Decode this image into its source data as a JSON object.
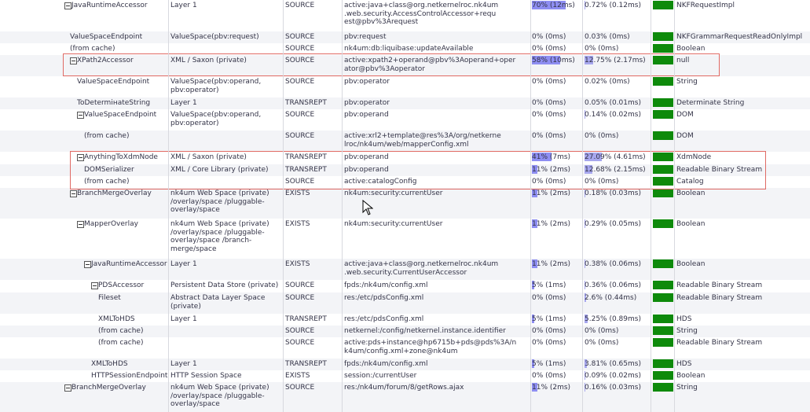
{
  "rows": [
    {
      "name": "JavaRuntimeAccessor",
      "toggle": true,
      "space": "Layer 1",
      "verb": "SOURCE",
      "uri": "active:java+class@org.netkernelroc.nk4um\n.web.security.AccessControlAccessor+requ\nest@pbv%3Arequest",
      "pct1": "70% (12ms)",
      "pct1_val": 70,
      "pct2": "0.72% (0.12ms)",
      "pct2_val": 0.72,
      "type": "NKFRequestImpl"
    },
    {
      "name": "ValueSpaceEndpoint",
      "toggle": false,
      "space": "ValueSpace(pbv:request)",
      "verb": "SOURCE",
      "uri": "pbv:request",
      "pct1": "0% (0ms)",
      "pct1_val": 0,
      "pct2": "0.03% (0ms)",
      "pct2_val": 0.03,
      "type": "NKFGrammarRequestReadOnlyImpl"
    },
    {
      "name": "(from cache)",
      "toggle": false,
      "space": "",
      "verb": "SOURCE",
      "uri": "nk4um:db:liquibase:updateAvailable",
      "pct1": "0% (0ms)",
      "pct1_val": 0,
      "pct2": "0% (0ms)",
      "pct2_val": 0,
      "type": "Boolean"
    },
    {
      "name": "XPath2Accessor",
      "toggle": true,
      "space": "XML / Saxon (private)",
      "verb": "SOURCE",
      "uri": "active:xpath2+operand@pbv%3Aoperand+oper\nator@pbv%3Aoperator",
      "pct1": "58% (10ms)",
      "pct1_val": 58,
      "pct2": "12.75% (2.17ms)",
      "pct2_val": 12.75,
      "type": "null"
    },
    {
      "name": "ValueSpaceEndpoint",
      "toggle": false,
      "space": "ValueSpace(pbv:operand,\npbv:operator)",
      "verb": "SOURCE",
      "uri": "pbv:operator",
      "pct1": "0% (0ms)",
      "pct1_val": 0,
      "pct2": "0.02% (0ms)",
      "pct2_val": 0.02,
      "type": "String"
    },
    {
      "name": "ToDetermінateString",
      "toggle": false,
      "space": "Layer 1",
      "verb": "TRANSREPT",
      "uri": "pbv:operator",
      "pct1": "0% (0ms)",
      "pct1_val": 0,
      "pct2": "0.05% (0.01ms)",
      "pct2_val": 0.05,
      "type": "Determinate String"
    },
    {
      "name": "ValueSpaceEndpoint",
      "toggle": true,
      "space": "ValueSpace(pbv:operand,\npbv:operator)",
      "verb": "SOURCE",
      "uri": "pbv:operand",
      "pct1": "0% (0ms)",
      "pct1_val": 0,
      "pct2": "0.14% (0.02ms)",
      "pct2_val": 0.14,
      "type": "DOM"
    },
    {
      "name": "(from cache)",
      "toggle": false,
      "space": "",
      "verb": "SOURCE",
      "uri": "active:xrl2+template@res%3A/org/netkerne\nlroc/nk4um/web/mapperConfig.xml",
      "pct1": "0% (0ms)",
      "pct1_val": 0,
      "pct2": "0% (0ms)",
      "pct2_val": 0,
      "type": "DOM"
    },
    {
      "name": "AnythingToXdmNode",
      "toggle": true,
      "space": "XML / Saxon (private)",
      "verb": "TRANSREPT",
      "uri": "pbv:operand",
      "pct1": "41% (7ms)",
      "pct1_val": 41,
      "pct2": "27.09% (4.61ms)",
      "pct2_val": 27.09,
      "type": "XdmNode"
    },
    {
      "name": "DOMSerializer",
      "toggle": false,
      "space": "XML / Core Library (private)",
      "verb": "TRANSREPT",
      "uri": "pbv:operand",
      "pct1": "11% (2ms)",
      "pct1_val": 11,
      "pct2": "12.68% (2.15ms)",
      "pct2_val": 12.68,
      "type": "Readable Binary Stream"
    },
    {
      "name": "(from cache)",
      "toggle": false,
      "space": "",
      "verb": "SOURCE",
      "uri": "active:catalogConfig",
      "pct1": "0% (0ms)",
      "pct1_val": 0,
      "pct2": "0% (0ms)",
      "pct2_val": 0,
      "type": "Catalog"
    },
    {
      "name": "BranchMergeOverlay",
      "toggle": true,
      "space": "nk4um Web Space (private)\n/overlay/space /pluggable-\noverlay/space",
      "verb": "EXISTS",
      "uri": "nk4um:security:currentUser",
      "pct1": "11% (2ms)",
      "pct1_val": 11,
      "pct2": "0.18% (0.03ms)",
      "pct2_val": 0.18,
      "type": "Boolean"
    },
    {
      "name": "MapperOverlay",
      "toggle": true,
      "space": "nk4um Web Space (private)\n/overlay/space /pluggable-\noverlay/space /branch-\nmerge/space",
      "verb": "EXISTS",
      "uri": "nk4um:security:currentUser",
      "pct1": "11% (2ms)",
      "pct1_val": 11,
      "pct2": "0.29% (0.05ms)",
      "pct2_val": 0.29,
      "type": "Boolean"
    },
    {
      "name": "JavaRuntimeAccessor",
      "toggle": true,
      "space": "Layer 1",
      "verb": "EXISTS",
      "uri": "active:java+class@org.netkernelroc.nk4um\n.web.security.CurrentUserAccessor",
      "pct1": "11% (2ms)",
      "pct1_val": 11,
      "pct2": "0.38% (0.06ms)",
      "pct2_val": 0.38,
      "type": "Boolean"
    },
    {
      "name": "PDSAccessor",
      "toggle": true,
      "space": "Persistent Data Store (private)",
      "verb": "SOURCE",
      "uri": "fpds:/nk4um/config.xml",
      "pct1": "5% (1ms)",
      "pct1_val": 5,
      "pct2": "0.36% (0.06ms)",
      "pct2_val": 0.36,
      "type": "Readable Binary Stream"
    },
    {
      "name": "Fileset",
      "toggle": false,
      "space": "Abstract Data Layer Space\n(private)",
      "verb": "SOURCE",
      "uri": "res:/etc/pdsConfig.xml",
      "pct1": "0% (0ms)",
      "pct1_val": 0,
      "pct2": "2.6% (0.44ms)",
      "pct2_val": 2.6,
      "type": "Readable Binary Stream"
    },
    {
      "name": "XMLToHDS",
      "toggle": false,
      "space": "Layer 1",
      "verb": "TRANSREPT",
      "uri": "res:/etc/pdsConfig.xml",
      "pct1": "5% (1ms)",
      "pct1_val": 5,
      "pct2": "5.25% (0.89ms)",
      "pct2_val": 5.25,
      "type": "HDS"
    },
    {
      "name": "(from cache)",
      "toggle": false,
      "space": "",
      "verb": "SOURCE",
      "uri": "netkernel:/config/netkernel.instance.identifier",
      "pct1": "0% (0ms)",
      "pct1_val": 0,
      "pct2": "0% (0ms)",
      "pct2_val": 0,
      "type": "String"
    },
    {
      "name": "(from cache)",
      "toggle": false,
      "space": "",
      "verb": "SOURCE",
      "uri": "active:pds+instance@hp6715b+pds@pds%3A/n\nk4um/config.xml+zone@nk4um",
      "pct1": "0% (0ms)",
      "pct1_val": 0,
      "pct2": "0% (0ms)",
      "pct2_val": 0,
      "type": "Readable Binary Stream"
    },
    {
      "name": "XMLToHDS",
      "toggle": false,
      "space": "Layer 1",
      "verb": "TRANSREPT",
      "uri": "fpds:/nk4um/config.xml",
      "pct1": "5% (1ms)",
      "pct1_val": 5,
      "pct2": "3.81% (0.65ms)",
      "pct2_val": 3.81,
      "type": "HDS"
    },
    {
      "name": "HTTPSessionEndpoint",
      "toggle": false,
      "space": "HTTP Session Space",
      "verb": "EXISTS",
      "uri": "session:/currentUser",
      "pct1": "0% (0ms)",
      "pct1_val": 0,
      "pct2": "0.09% (0.02ms)",
      "pct2_val": 0.09,
      "type": "Boolean"
    },
    {
      "name": "BranchMergeOverlay",
      "toggle": true,
      "space": "nk4um Web Space (private)\n/overlay/space /pluggable-\noverlay/space",
      "verb": "SOURCE",
      "uri": "res:/nk4um/forum/8/getRows.ajax",
      "pct1": "11% (2ms)",
      "pct1_val": 11,
      "pct2": "0.16% (0.03ms)",
      "pct2_val": 0.16,
      "type": "String"
    }
  ]
}
